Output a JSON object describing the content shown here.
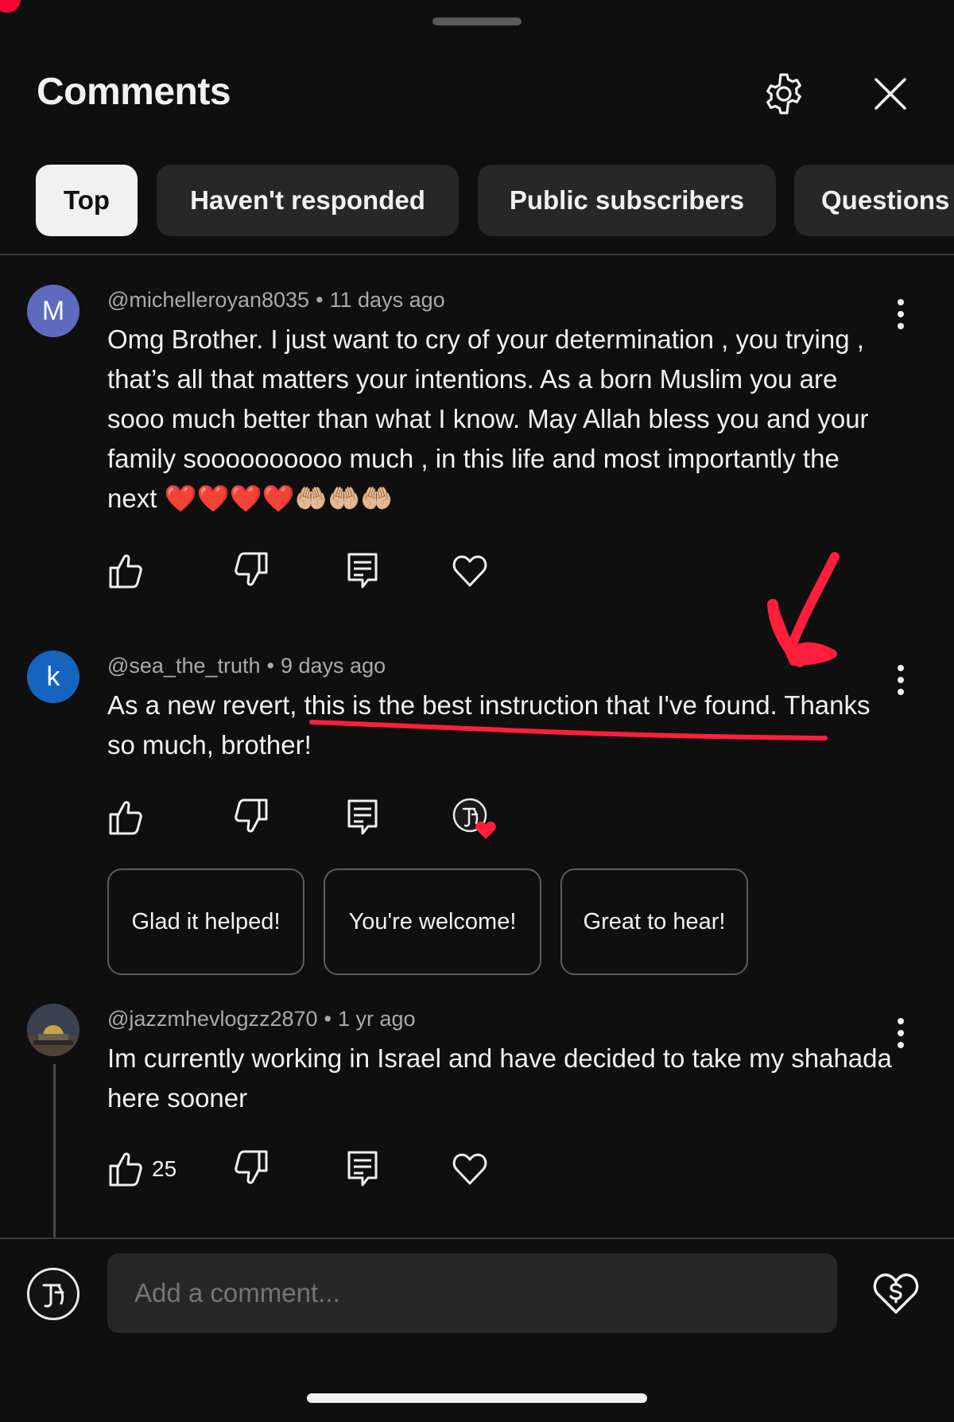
{
  "header": {
    "title": "Comments",
    "settings_icon": "gear-icon",
    "close_icon": "close-icon"
  },
  "filters": [
    {
      "label": "Top",
      "active": true
    },
    {
      "label": "Haven't responded",
      "active": false
    },
    {
      "label": "Public subscribers",
      "active": false
    },
    {
      "label": "Questions",
      "active": false
    }
  ],
  "comments": [
    {
      "avatar_letter": "M",
      "avatar_color": "#5c6bc0",
      "author": "@michelleroyan8035",
      "time": "11 days ago",
      "text": "Omg Brother. I just want to cry of your determination , you trying , that’s all that matters your intentions. As a born Muslim you are sooo much better than what I know. May Allah bless you and your family soooooooooo much , in this life and most importantly the next ❤️❤️❤️❤️🤲🏼🤲🏼🤲🏼"
    },
    {
      "avatar_letter": "k",
      "avatar_color": "#1565c0",
      "author": "@sea_the_truth",
      "time": "9 days ago",
      "text": "As a new revert, this is the best instruction that I've found. Thanks so much, brother!",
      "creator_hearted": true,
      "suggested_replies": [
        "Glad it helped!",
        "You're welcome!",
        "Great to hear!"
      ]
    },
    {
      "author": "@jazzmhevlogzz2870",
      "time": "1 yr ago",
      "text": "Im currently working in Israel and have decided to take my shahada here sooner",
      "like_count": "25"
    }
  ],
  "composer": {
    "placeholder": "Add a comment...",
    "thanks_icon": "super-thanks-icon"
  },
  "colors": {
    "background": "#0f0f0f",
    "chip": "#272727",
    "annotation_red": "#ff1e3c"
  }
}
